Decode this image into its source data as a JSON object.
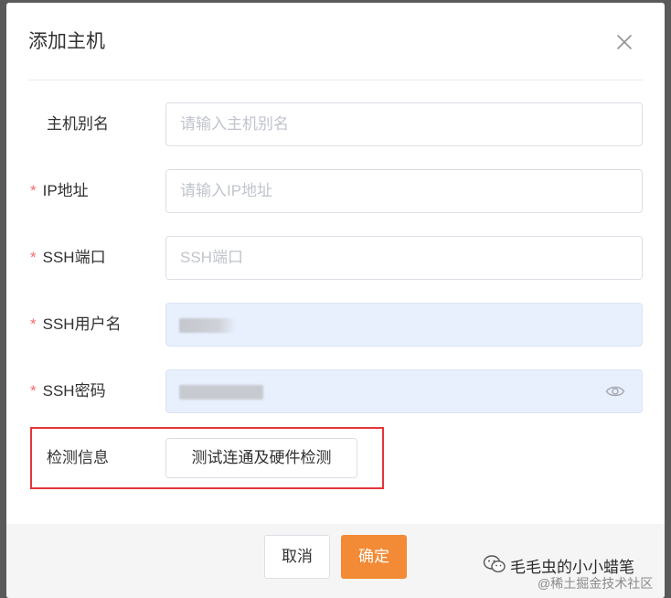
{
  "dialog": {
    "title": "添加主机",
    "close_icon": "close-icon"
  },
  "form": {
    "alias": {
      "label": "主机别名",
      "required": false,
      "placeholder": "请输入主机别名",
      "value": ""
    },
    "ip": {
      "label": "IP地址",
      "required": true,
      "placeholder": "请输入IP地址",
      "value": ""
    },
    "port": {
      "label": "SSH端口",
      "required": true,
      "placeholder": "SSH端口",
      "value": ""
    },
    "username": {
      "label": "SSH用户名",
      "required": true,
      "placeholder": "",
      "value": ""
    },
    "password": {
      "label": "SSH密码",
      "required": true,
      "placeholder": "",
      "value": "",
      "toggle_icon": "eye-icon"
    },
    "detect": {
      "label": "检测信息",
      "button_label": "测试连通及硬件检测"
    },
    "required_mark": "*"
  },
  "footer": {
    "cancel_label": "取消",
    "confirm_label": "确定"
  },
  "watermark": {
    "line1": "毛毛虫的小小蜡笔",
    "line2": "@稀土掘金技术社区",
    "icon": "wechat-icon"
  },
  "colors": {
    "accent": "#f38a35",
    "required": "#f56c6c",
    "highlight_border": "#e3373a",
    "autofill_bg": "#e8f0fe"
  }
}
